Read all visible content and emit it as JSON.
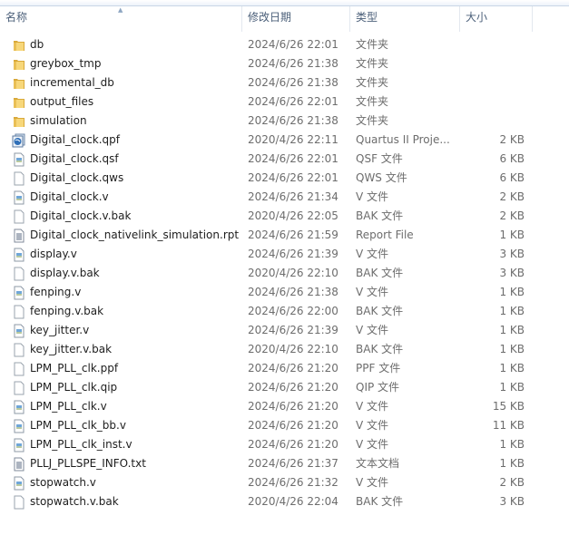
{
  "columns": {
    "name": "名称",
    "date": "修改日期",
    "type": "类型",
    "size": "大小"
  },
  "files": [
    {
      "name": "db",
      "date": "2024/6/26 22:01",
      "type": "文件夹",
      "size": "",
      "icon": "folder"
    },
    {
      "name": "greybox_tmp",
      "date": "2024/6/26 21:38",
      "type": "文件夹",
      "size": "",
      "icon": "folder"
    },
    {
      "name": "incremental_db",
      "date": "2024/6/26 21:38",
      "type": "文件夹",
      "size": "",
      "icon": "folder"
    },
    {
      "name": "output_files",
      "date": "2024/6/26 22:01",
      "type": "文件夹",
      "size": "",
      "icon": "folder"
    },
    {
      "name": "simulation",
      "date": "2024/6/26 21:38",
      "type": "文件夹",
      "size": "",
      "icon": "folder"
    },
    {
      "name": "Digital_clock.qpf",
      "date": "2020/4/26 22:11",
      "type": "Quartus II Proje...",
      "size": "2 KB",
      "icon": "project"
    },
    {
      "name": "Digital_clock.qsf",
      "date": "2024/6/26 22:01",
      "type": "QSF 文件",
      "size": "6 KB",
      "icon": "image-file"
    },
    {
      "name": "Digital_clock.qws",
      "date": "2024/6/26 22:01",
      "type": "QWS 文件",
      "size": "6 KB",
      "icon": "blank-file"
    },
    {
      "name": "Digital_clock.v",
      "date": "2024/6/26 21:34",
      "type": "V 文件",
      "size": "2 KB",
      "icon": "image-file"
    },
    {
      "name": "Digital_clock.v.bak",
      "date": "2020/4/26 22:05",
      "type": "BAK 文件",
      "size": "2 KB",
      "icon": "blank-file"
    },
    {
      "name": "Digital_clock_nativelink_simulation.rpt",
      "date": "2024/6/26 21:59",
      "type": "Report File",
      "size": "1 KB",
      "icon": "text-file"
    },
    {
      "name": "display.v",
      "date": "2024/6/26 21:39",
      "type": "V 文件",
      "size": "3 KB",
      "icon": "image-file"
    },
    {
      "name": "display.v.bak",
      "date": "2020/4/26 22:10",
      "type": "BAK 文件",
      "size": "3 KB",
      "icon": "blank-file"
    },
    {
      "name": "fenping.v",
      "date": "2024/6/26 21:38",
      "type": "V 文件",
      "size": "1 KB",
      "icon": "image-file"
    },
    {
      "name": "fenping.v.bak",
      "date": "2024/6/26 22:00",
      "type": "BAK 文件",
      "size": "1 KB",
      "icon": "blank-file"
    },
    {
      "name": "key_jitter.v",
      "date": "2024/6/26 21:39",
      "type": "V 文件",
      "size": "1 KB",
      "icon": "image-file"
    },
    {
      "name": "key_jitter.v.bak",
      "date": "2020/4/26 22:10",
      "type": "BAK 文件",
      "size": "1 KB",
      "icon": "blank-file"
    },
    {
      "name": "LPM_PLL_clk.ppf",
      "date": "2024/6/26 21:20",
      "type": "PPF 文件",
      "size": "1 KB",
      "icon": "blank-file"
    },
    {
      "name": "LPM_PLL_clk.qip",
      "date": "2024/6/26 21:20",
      "type": "QIP 文件",
      "size": "1 KB",
      "icon": "blank-file"
    },
    {
      "name": "LPM_PLL_clk.v",
      "date": "2024/6/26 21:20",
      "type": "V 文件",
      "size": "15 KB",
      "icon": "image-file"
    },
    {
      "name": "LPM_PLL_clk_bb.v",
      "date": "2024/6/26 21:20",
      "type": "V 文件",
      "size": "11 KB",
      "icon": "image-file"
    },
    {
      "name": "LPM_PLL_clk_inst.v",
      "date": "2024/6/26 21:20",
      "type": "V 文件",
      "size": "1 KB",
      "icon": "image-file"
    },
    {
      "name": "PLLJ_PLLSPE_INFO.txt",
      "date": "2024/6/26 21:37",
      "type": "文本文档",
      "size": "1 KB",
      "icon": "text-file"
    },
    {
      "name": "stopwatch.v",
      "date": "2024/6/26 21:32",
      "type": "V 文件",
      "size": "2 KB",
      "icon": "image-file"
    },
    {
      "name": "stopwatch.v.bak",
      "date": "2020/4/26 22:04",
      "type": "BAK 文件",
      "size": "3 KB",
      "icon": "blank-file"
    }
  ]
}
